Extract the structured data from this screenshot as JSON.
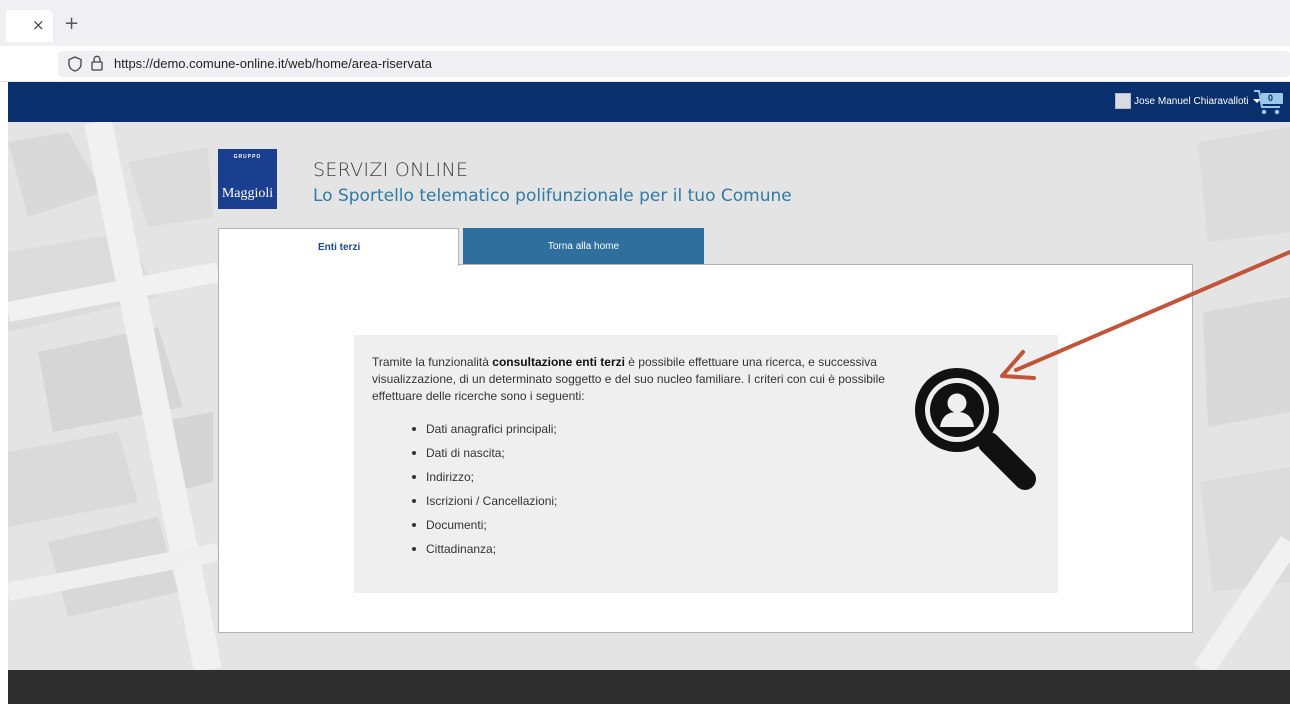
{
  "browser": {
    "tab_close": "×",
    "new_tab": "+",
    "url": "https://demo.comune-online.it/web/home/area-riservata"
  },
  "navbar": {
    "user_name": "Jose Manuel Chiaravalloti",
    "cart_count": "0",
    "background_color": "#0a2f6d"
  },
  "logo": {
    "group": "GRUPPO",
    "name": "Maggioli"
  },
  "header": {
    "title": "SERVIZI ONLINE",
    "subtitle": "Lo Sportello telematico polifunzionale per il tuo Comune"
  },
  "tabs": [
    {
      "label": "Enti terzi",
      "active": true
    },
    {
      "label": "Torna alla home",
      "active": false
    }
  ],
  "content": {
    "intro_before": "Tramite la funzionalità ",
    "intro_bold": "consultazione enti terzi",
    "intro_after": " è possibile effettuare una ricerca, e successiva visualizzazione, di un determinato soggetto e del suo nucleo familiare. I criteri con cui è possibile effettuare delle ricerche sono i seguenti:",
    "criteria": [
      "Dati anagrafici principali;",
      "Dati di nascita;",
      "Indirizzo;",
      "Iscrizioni / Cancellazioni;",
      "Documenti;",
      "Cittadinanza;"
    ]
  },
  "icons": {
    "shield": "shield-icon",
    "lock": "lock-icon",
    "cart": "cart-icon",
    "search_person": "person-search-icon",
    "annotation": "arrow-annotation"
  },
  "colors": {
    "accent_blue": "#2e6f9e",
    "subtitle_blue": "#2f7aa6",
    "annotation_red": "#c0553a"
  }
}
